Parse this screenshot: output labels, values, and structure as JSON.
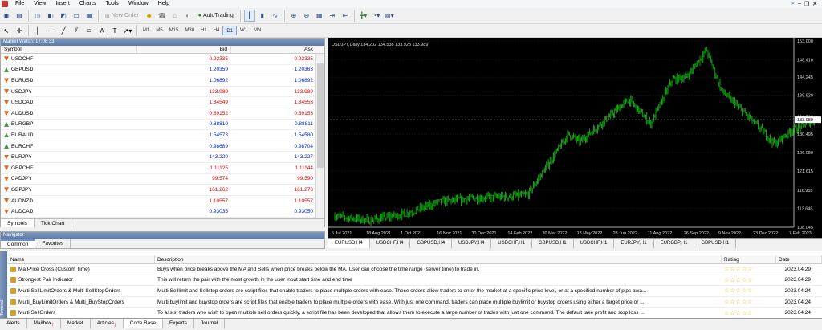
{
  "menu": [
    "File",
    "View",
    "Insert",
    "Charts",
    "Tools",
    "Window",
    "Help"
  ],
  "toolbar": {
    "new_order": "New Order",
    "autotrading": "AutoTrading",
    "timeframes": [
      "M1",
      "M5",
      "M15",
      "M30",
      "H1",
      "H4",
      "D1",
      "W1",
      "MN"
    ],
    "active_timeframe": "D1"
  },
  "market_watch": {
    "title": "Market Watch: 17:08:33",
    "headers": {
      "symbol": "Symbol",
      "bid": "Bid",
      "ask": "Ask"
    },
    "rows": [
      {
        "symbol": "USDCHF",
        "bid": "0.92335",
        "ask": "0.92335",
        "dir": "down",
        "color": "red"
      },
      {
        "symbol": "GBPUSD",
        "bid": "1.20359",
        "ask": "1.20363",
        "dir": "up",
        "color": "blue"
      },
      {
        "symbol": "EURUSD",
        "bid": "1.06892",
        "ask": "1.06892",
        "dir": "down",
        "color": "blue"
      },
      {
        "symbol": "USDJPY",
        "bid": "133.989",
        "ask": "133.989",
        "dir": "down",
        "color": "red"
      },
      {
        "symbol": "USDCAD",
        "bid": "1.34549",
        "ask": "1.34553",
        "dir": "down",
        "color": "red"
      },
      {
        "symbol": "AUDUSD",
        "bid": "0.69152",
        "ask": "0.69153",
        "dir": "down",
        "color": "red"
      },
      {
        "symbol": "EURGBP",
        "bid": "0.88810",
        "ask": "0.88811",
        "dir": "up",
        "color": "blue"
      },
      {
        "symbol": "EURAUD",
        "bid": "1.54573",
        "ask": "1.54580",
        "dir": "up",
        "color": "blue"
      },
      {
        "symbol": "EURCHF",
        "bid": "0.98689",
        "ask": "0.98704",
        "dir": "up",
        "color": "blue"
      },
      {
        "symbol": "EURJPY",
        "bid": "143.220",
        "ask": "143.227",
        "dir": "down",
        "color": "blue"
      },
      {
        "symbol": "GBPCHF",
        "bid": "1.11125",
        "ask": "1.11144",
        "dir": "down",
        "color": "red"
      },
      {
        "symbol": "CADJPY",
        "bid": "99.574",
        "ask": "99.590",
        "dir": "down",
        "color": "red"
      },
      {
        "symbol": "GBPJPY",
        "bid": "161.262",
        "ask": "161.276",
        "dir": "down",
        "color": "red"
      },
      {
        "symbol": "AUDNZD",
        "bid": "1.10557",
        "ask": "1.10557",
        "dir": "down",
        "color": "red"
      },
      {
        "symbol": "AUDCAD",
        "bid": "0.93035",
        "ask": "0.93050",
        "dir": "down",
        "color": "blue"
      }
    ],
    "tabs": [
      "Symbols",
      "Tick Chart"
    ]
  },
  "navigator": {
    "title": "Navigator",
    "tabs": [
      "Common",
      "Favorites"
    ]
  },
  "chart": {
    "info": "USDJPY,Daily  134.202 134.538 133.923 133.989",
    "price_ticks": [
      "153.000",
      "148.410",
      "144.245",
      "139.920",
      "134.710",
      "130.495",
      "126.080",
      "121.615",
      "116.955",
      "112.645",
      "108.045"
    ],
    "current_price": "133.989",
    "date_ticks": [
      "5 Jul 2021",
      "18 Aug 2021",
      "1 Oct 2021",
      "16 Nov 2021",
      "30 Dec 2021",
      "14 Feb 2022",
      "30 Mar 2022",
      "13 May 2022",
      "28 Jun 2022",
      "11 Aug 2022",
      "26 Sep 2022",
      "9 Nov 2022",
      "23 Dec 2022",
      "7 Feb 2023"
    ]
  },
  "chart_tabs": [
    "EURUSD,H4",
    "USDCHF,H4",
    "GBPUSD,H4",
    "USDJPY,H4",
    "USDCHF,H1",
    "GBPUSD,H1",
    "USDCHF,H1",
    "EURJPY,H1",
    "EURGBP,H1",
    "GBPUSD,H1"
  ],
  "chart_data": {
    "type": "bar",
    "title": "USDJPY,Daily  134.202 134.538 133.923 133.989",
    "x_range": [
      "5 Jul 2021",
      "7 Feb 2023"
    ],
    "y_range": [
      108.045,
      153.0
    ],
    "anchors": [
      {
        "x": "5 Jul 2021",
        "y": 110.8
      },
      {
        "x": "18 Aug 2021",
        "y": 109.7
      },
      {
        "x": "1 Oct 2021",
        "y": 111.2
      },
      {
        "x": "16 Nov 2021",
        "y": 114.2
      },
      {
        "x": "30 Dec 2021",
        "y": 115.1
      },
      {
        "x": "14 Feb 2022",
        "y": 115.5
      },
      {
        "x": "7 Mar 2022",
        "y": 115.8
      },
      {
        "x": "30 Mar 2022",
        "y": 122.2
      },
      {
        "x": "28 Apr 2022",
        "y": 130.5
      },
      {
        "x": "13 May 2022",
        "y": 128.7
      },
      {
        "x": "28 Jun 2022",
        "y": 136.2
      },
      {
        "x": "14 Jul 2022",
        "y": 138.9
      },
      {
        "x": "11 Aug 2022",
        "y": 133.0
      },
      {
        "x": "7 Sep 2022",
        "y": 143.6
      },
      {
        "x": "26 Sep 2022",
        "y": 144.5
      },
      {
        "x": "21 Oct 2022",
        "y": 150.8
      },
      {
        "x": "9 Nov 2022",
        "y": 141.0
      },
      {
        "x": "23 Dec 2022",
        "y": 132.8
      },
      {
        "x": "16 Jan 2023",
        "y": 128.2
      },
      {
        "x": "7 Feb 2023",
        "y": 131.5
      },
      {
        "x": "9 Mar 2023",
        "y": 134.0
      }
    ]
  },
  "codebase": {
    "headers": {
      "name": "Name",
      "description": "Description",
      "rating": "Rating",
      "date": "Date"
    },
    "rows": [
      {
        "name": "Ma Price Cross (Custom Time)",
        "desc": "Buys when price breaks above the MA and Sells when price breaks below the MA. User can choose the time range (server time) to trade in.",
        "rating": "☆☆☆☆☆",
        "date": "2023.04.29"
      },
      {
        "name": "Strongest Pair Indicator",
        "desc": "This will return the pair with the most growth in the user input start time and end time",
        "rating": "☆☆☆☆☆",
        "date": "2023.04.29"
      },
      {
        "name": "Multi SellLimitOrders & Multi SellStopOrders",
        "desc": "Multi Selllimit and Sellstop orders are script files that enable traders to place multiple orders with ease. These orders allow traders to enter the market at a specific price level, or at a specified number of pips awa...",
        "rating": "☆☆☆☆☆",
        "date": "2023.04.24"
      },
      {
        "name": "Multi_BuyLimitOrders & Multi_BuyStopOrders",
        "desc": "Multi buylimit and buystop orders are script files that enable traders to place multiple orders with ease. With just one command, traders can place multiple buylimit or buystop orders using either a target price or ...",
        "rating": "☆☆☆☆☆",
        "date": "2023.04.24"
      },
      {
        "name": "Multi SellOrders",
        "desc": "To assist traders who wish to open multiple sell orders quickly, a script file has been developed that allows them to execute a large number of trades with just one command. The default take profit and stop loss ...",
        "rating": "☆☆☆☆☆",
        "date": "2023.04.24"
      }
    ]
  },
  "bottom_tabs": [
    {
      "label": "Alerts",
      "badge": ""
    },
    {
      "label": "Mailbox",
      "badge": "7"
    },
    {
      "label": "Market",
      "badge": ""
    },
    {
      "label": "Articles",
      "badge": "1"
    },
    {
      "label": "Code Base",
      "badge": ""
    },
    {
      "label": "Experts",
      "badge": ""
    },
    {
      "label": "Journal",
      "badge": ""
    }
  ],
  "toolbox_label": "Terminal"
}
